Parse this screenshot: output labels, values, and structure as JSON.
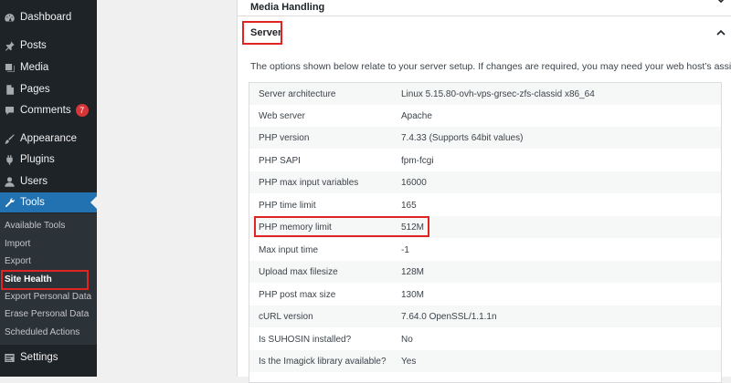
{
  "sidebar": {
    "items": [
      {
        "label": "Dashboard",
        "icon": "dashboard-icon"
      },
      {
        "label": "Posts",
        "icon": "pin-icon"
      },
      {
        "label": "Media",
        "icon": "media-icon"
      },
      {
        "label": "Pages",
        "icon": "page-icon"
      },
      {
        "label": "Comments",
        "icon": "comment-icon",
        "badge": "7"
      },
      {
        "label": "Appearance",
        "icon": "brush-icon"
      },
      {
        "label": "Plugins",
        "icon": "plug-icon"
      },
      {
        "label": "Users",
        "icon": "user-icon"
      },
      {
        "label": "Tools",
        "icon": "wrench-icon",
        "active": true
      },
      {
        "label": "Settings",
        "icon": "settings-icon"
      }
    ],
    "submenu": [
      "Available Tools",
      "Import",
      "Export",
      "Site Health",
      "Export Personal Data",
      "Erase Personal Data",
      "Scheduled Actions"
    ],
    "submenu_current": "Site Health"
  },
  "accordion": {
    "previous_title": "Media Handling",
    "section_title": "Server",
    "description": "The options shown below relate to your server setup. If changes are required, you may need your web host’s assistance."
  },
  "server_info": [
    {
      "key": "Server architecture",
      "value": "Linux 5.15.80-ovh-vps-grsec-zfs-classid x86_64"
    },
    {
      "key": "Web server",
      "value": "Apache"
    },
    {
      "key": "PHP version",
      "value": "7.4.33 (Supports 64bit values)"
    },
    {
      "key": "PHP SAPI",
      "value": "fpm-fcgi"
    },
    {
      "key": "PHP max input variables",
      "value": "16000"
    },
    {
      "key": "PHP time limit",
      "value": "165"
    },
    {
      "key": "PHP memory limit",
      "value": "512M"
    },
    {
      "key": "Max input time",
      "value": "-1"
    },
    {
      "key": "Upload max filesize",
      "value": "128M"
    },
    {
      "key": "PHP post max size",
      "value": "130M"
    },
    {
      "key": "cURL version",
      "value": "7.64.0 OpenSSL/1.1.1n"
    },
    {
      "key": "Is SUHOSIN installed?",
      "value": "No"
    },
    {
      "key": "Is the Imagick library available?",
      "value": "Yes"
    }
  ],
  "colors": {
    "sidebar_bg": "#1d2327",
    "active_bg": "#2271b1",
    "highlight": "#e02424",
    "badge": "#d63638"
  }
}
